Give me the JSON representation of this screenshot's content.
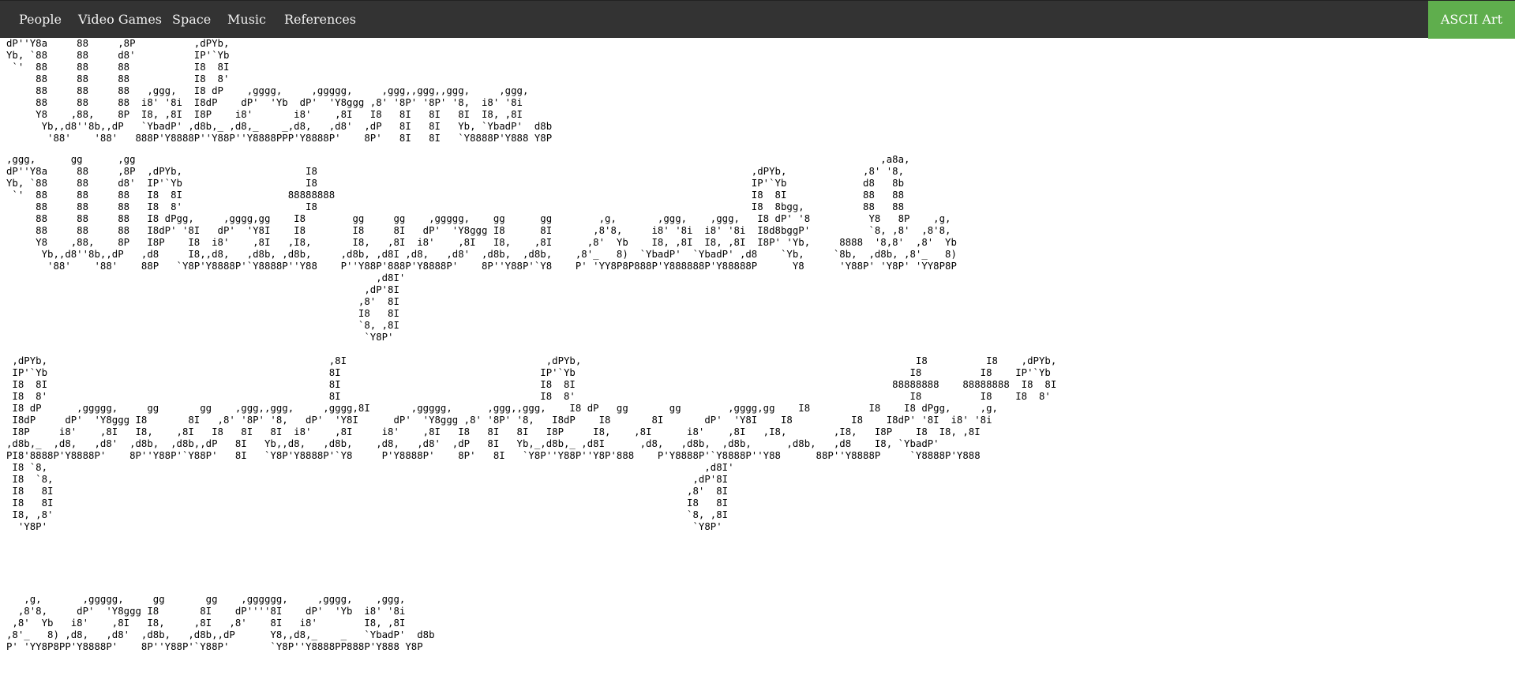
{
  "nav": {
    "items": [
      {
        "label": "People"
      },
      {
        "label": "Video Games"
      },
      {
        "label": "Space"
      },
      {
        "label": "Music"
      },
      {
        "label": "References"
      }
    ],
    "active_label": "ASCII Art",
    "bar_color": "#333333",
    "active_color": "#5fae4d"
  },
  "art": {
    "block1": "dP''Y8a     88     ,8P          ,dPYb,\nYb, `88     88     d8'          IP'`Yb\n `'  88     88     88           I8  8I\n     88     88     88           I8  8'\n     88     88     88   ,ggg,   I8 dP    ,gggg,     ,ggggg,     ,ggg,,ggg,,ggg,     ,ggg,\n     88     88     88  i8' '8i  I8dP    dP'  'Yb  dP'  'Y8ggg ,8' '8P' '8P' '8,  i8' '8i\n     Y8    ,88,    8P  I8, ,8I  I8P    i8'       i8'    ,8I   I8   8I   8I   8I  I8, ,8I\n      Yb,,d8''8b,,dP   `YbadP' ,d8b,_ ,d8,_    _,d8,   ,d8'  ,dP   8I   8I   Yb, `YbadP'  d8b\n       '88'    '88'   888P'Y8888P''Y88P''Y8888PPP'Y8888P'    8P'   8I   8I   `Y8888P'Y888 Y8P",
    "block2": ",ggg,      gg      ,gg                                                                                                                               ,a8a,\ndP''Y8a     88     ,8P  ,dPYb,                     I8                                                                          ,dPYb,             ,8' '8,\nYb, `88     88     d8'  IP'`Yb                     I8                                                                          IP'`Yb             d8   8b\n `'  88     88     88   I8  8I                  88888888                                                                       I8  8I             88   88\n     88     88     88   I8  8'                     I8                                                                          I8  8bgg,          88   88\n     88     88     88   I8 dPgg,     ,gggg,gg    I8        gg     gg    ,ggggg,    gg      gg        ,g,       ,ggg,    ,ggg,   I8 dP' '8          Y8   8P    ,g,\n     88     88     88   I8dP' '8I   dP'  'Y8I    I8        I8     8I   dP'  'Y8ggg I8      8I       ,8'8,     i8' '8i  i8' '8i  I8d8bggP'          `8, ,8'  ,8'8,\n     Y8    ,88,    8P   I8P    I8  i8'    ,8I   ,I8,       I8,   ,8I  i8'    ,8I   I8,    ,8I      ,8'  Yb    I8, ,8I  I8, ,8I  I8P' 'Yb,     8888  '8,8'  ,8'  Yb\n      Yb,,d8''8b,,dP   ,d8     I8,,d8,   ,d8b, ,d8b,     ,d8b, ,d8I ,d8,   ,d8'  ,d8b,  ,d8b,    ,8'_   8)  `YbadP'  `YbadP' ,d8    `Yb,     `8b,  ,d8b, ,8'_   8)\n       '88'    '88'    88P   `Y8P'Y8888P'`Y8888P''Y88    P''Y88P'888P'Y8888P'    8P''Y88P'`Y8    P' 'YY8P8P888P'Y888888P'Y88888P      Y8      'Y88P' 'Y8P' 'YY8P8P\n                                                               ,d8I'\n                                                             ,dP'8I\n                                                            ,8'  8I\n                                                            I8   8I\n                                                            `8, ,8I\n                                                             `Y8P'",
    "block3": " ,dPYb,                                                ,8I                                  ,dPYb,                                                         I8          I8    ,dPYb,\n IP'`Yb                                                8I                                  IP'`Yb                                                         I8          I8    IP'`Yb\n I8  8I                                                8I                                  I8  8I                                                      88888888    88888888  I8  8I\n I8  8'                                                8I                                  I8  8'                                                         I8          I8    I8  8'\n I8 dP      ,ggggg,     gg       gg    ,ggg,,ggg,     ,gggg,8I       ,ggggg,      ,ggg,,ggg,    I8 dP   gg       gg        ,gggg,gg    I8          I8    I8 dPgg,     ,g,\n I8dP     dP'  'Y8ggg I8       8I   ,8' '8P' '8,   dP'  'Y8I      dP'  'Y8ggg ,8' '8P' '8,   I8dP    I8       8I       dP'  'Y8I    I8          I8    I8dP' '8I  i8' '8i\n I8P     i8'    ,8I   I8,    ,8I   I8   8I   8I  i8'    ,8I     i8'    ,8I   I8   8I   8I   I8P     I8,    ,8I      i8'    ,8I   ,I8,        ,I8,   I8P    I8  I8, ,8I\n,d8b,_  ,d8,   ,d8'  ,d8b,  ,d8b,,dP   8I   Yb,,d8,   ,d8b,    ,d8,   ,d8'  ,dP   8I   Yb,_,d8b,_ ,d8I      ,d8,   ,d8b,  ,d8b,      ,d8b,   ,d8    I8, `YbadP'\nPI8'8888P'Y8888P'    8P''Y88P'`Y88P'   8I   `Y8P'Y8888P'`Y8     P'Y8888P'    8P'   8I   `Y8P''Y88P''Y8P'888    P'Y8888P'`Y8888P''Y88      88P''Y8888P     `Y8888P'Y888\n I8 `8,                                                                                                                ,d8I'\n I8  `8,                                                                                                             ,dP'8I\n I8   8I                                                                                                            ,8'  8I\n I8   8I                                                                                                            I8   8I\n I8, ,8'                                                                                                            `8, ,8I\n  'Y8P'                                                                                                              `Y8P'",
    "block4": "   ,g,       ,ggggg,     gg       gg    ,gggggg,     ,gggg,    ,ggg,\n  ,8'8,     dP'  'Y8ggg I8       8I    dP''''8I    dP'  'Yb  i8' '8i\n ,8'  Yb   i8'    ,8I   I8,     ,8I   ,8'    8I   i8'        I8, ,8I\n,8'_   8) ,d8,   ,d8'  ,d8b,   ,d8b,,dP      Y8,,d8,_    _   `YbadP'  d8b\nP' 'YY8P8PP'Y8888P'    8P''Y88P'`Y88P'       `Y8P''Y8888PP888P'Y888 Y8P"
  }
}
